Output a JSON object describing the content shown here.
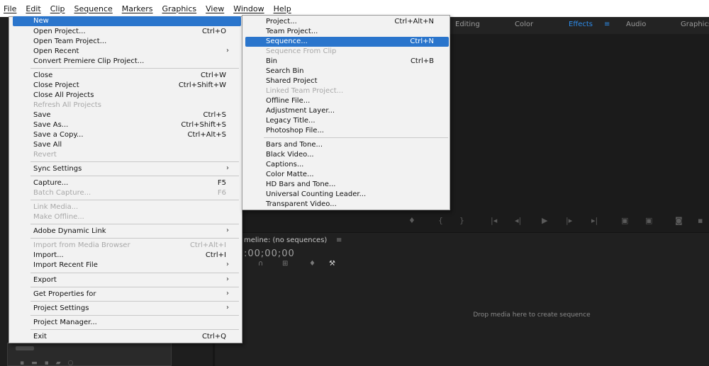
{
  "menubar": [
    "File",
    "Edit",
    "Clip",
    "Sequence",
    "Markers",
    "Graphics",
    "View",
    "Window",
    "Help"
  ],
  "workspaces": [
    "Editing",
    "Color",
    "Effects",
    "Audio",
    "Graphics"
  ],
  "workspace_menu_icon": "≡",
  "file_menu": {
    "items": [
      {
        "label": "New",
        "highlighted": true
      },
      {
        "label": "Open Project...",
        "shortcut": "Ctrl+O"
      },
      {
        "label": "Open Team Project..."
      },
      {
        "label": "Open Recent",
        "submenu": true
      },
      {
        "label": "Convert Premiere Clip Project..."
      },
      {
        "label": "Close",
        "shortcut": "Ctrl+W"
      },
      {
        "label": "Close Project",
        "shortcut": "Ctrl+Shift+W"
      },
      {
        "label": "Close All Projects"
      },
      {
        "label": "Refresh All Projects",
        "disabled": true
      },
      {
        "label": "Save",
        "shortcut": "Ctrl+S"
      },
      {
        "label": "Save As...",
        "shortcut": "Ctrl+Shift+S"
      },
      {
        "label": "Save a Copy...",
        "shortcut": "Ctrl+Alt+S"
      },
      {
        "label": "Save All"
      },
      {
        "label": "Revert",
        "disabled": true
      },
      {
        "label": "Sync Settings",
        "submenu": true
      },
      {
        "label": "Capture...",
        "shortcut": "F5"
      },
      {
        "label": "Batch Capture...",
        "shortcut": "F6",
        "disabled": true
      },
      {
        "label": "Link Media...",
        "disabled": true
      },
      {
        "label": "Make Offline...",
        "disabled": true
      },
      {
        "label": "Adobe Dynamic Link",
        "submenu": true
      },
      {
        "label": "Import from Media Browser",
        "shortcut": "Ctrl+Alt+I",
        "disabled": true
      },
      {
        "label": "Import...",
        "shortcut": "Ctrl+I"
      },
      {
        "label": "Import Recent File",
        "submenu": true
      },
      {
        "label": "Export",
        "submenu": true
      },
      {
        "label": "Get Properties for",
        "submenu": true
      },
      {
        "label": "Project Settings",
        "submenu": true
      },
      {
        "label": "Project Manager..."
      },
      {
        "label": "Exit",
        "shortcut": "Ctrl+Q"
      }
    ]
  },
  "new_submenu": {
    "items": [
      {
        "label": "Project...",
        "shortcut": "Ctrl+Alt+N"
      },
      {
        "label": "Team Project..."
      },
      {
        "label": "Sequence...",
        "shortcut": "Ctrl+N",
        "highlighted": true
      },
      {
        "label": "Sequence From Clip",
        "disabled": true
      },
      {
        "label": "Bin",
        "shortcut": "Ctrl+B"
      },
      {
        "label": "Search Bin"
      },
      {
        "label": "Shared Project"
      },
      {
        "label": "Linked Team Project...",
        "disabled": true
      },
      {
        "label": "Offline File..."
      },
      {
        "label": "Adjustment Layer..."
      },
      {
        "label": "Legacy Title..."
      },
      {
        "label": "Photoshop File..."
      },
      {
        "label": "Bars and Tone..."
      },
      {
        "label": "Black Video..."
      },
      {
        "label": "Captions..."
      },
      {
        "label": "Color Matte..."
      },
      {
        "label": "HD Bars and Tone..."
      },
      {
        "label": "Universal Counting Leader..."
      },
      {
        "label": "Transparent Video..."
      }
    ]
  },
  "timeline": {
    "title": "meline: (no sequences)",
    "menu_icon": "≡",
    "timecode": ":00;00;00",
    "drop_hint": "Drop media here to create sequence"
  },
  "colors": {
    "highlight": "#2a75cc",
    "active_workspace": "#2d8ceb"
  }
}
